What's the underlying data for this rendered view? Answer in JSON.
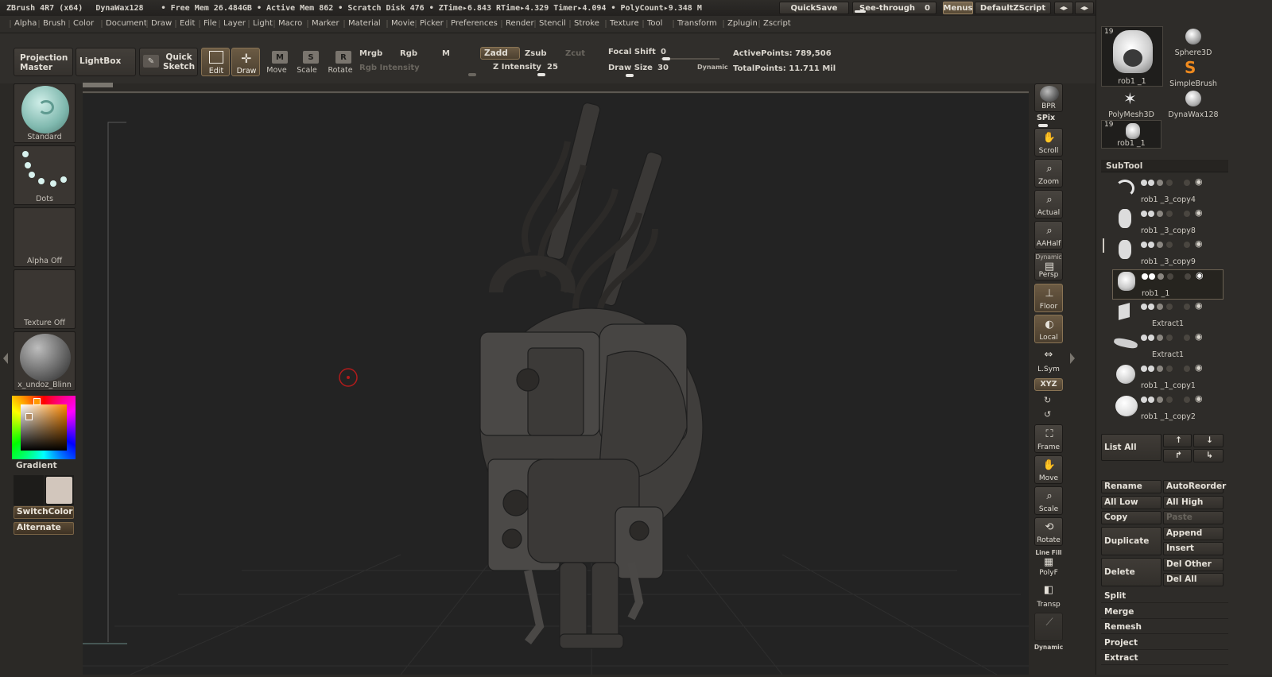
{
  "titlebar": {
    "app": "ZBrush 4R7 (x64)",
    "doc": "DynaWax128",
    "stats": "• Free Mem 26.484GB • Active Mem 862 • Scratch Disk 476 •  ZTime▸6.843 RTime▸4.329 Timer▸4.094 • PolyCount▸9.348 M",
    "quicksave": "QuickSave",
    "seethrough_label": "See-through",
    "seethrough_value": "0",
    "menus": "Menus",
    "script": "DefaultZScript"
  },
  "menubar": [
    "Alpha",
    "Brush",
    "Color",
    "Document",
    "Draw",
    "Edit",
    "File",
    "Layer",
    "Light",
    "Macro",
    "Marker",
    "Material",
    "Movie",
    "Picker",
    "Preferences",
    "Render",
    "Stencil",
    "Stroke",
    "Texture",
    "Tool",
    "Transform",
    "Zplugin",
    "Zscript"
  ],
  "toolbar": {
    "projection_master": "Projection Master",
    "lightbox": "LightBox",
    "quick_sketch": "Quick Sketch",
    "edit": "Edit",
    "draw": "Draw",
    "move": "Move",
    "scale": "Scale",
    "rotate": "Rotate",
    "mrgb": "Mrgb",
    "rgb": "Rgb",
    "m": "M",
    "zadd": "Zadd",
    "zsub": "Zsub",
    "zcut": "Zcut",
    "rgb_intensity": "Rgb Intensity",
    "z_intensity_label": "Z Intensity",
    "z_intensity_value": "25",
    "focal_shift_label": "Focal Shift",
    "focal_shift_value": "0",
    "draw_size_label": "Draw Size",
    "draw_size_value": "30",
    "dynamic": "Dynamic",
    "active_points": "ActivePoints: 789,506",
    "total_points": "TotalPoints: 11.711 Mil"
  },
  "leftshelf": {
    "brush": "Standard",
    "stroke": "Dots",
    "alpha": "Alpha  Off",
    "texture": "Texture  Off",
    "material": "x_undoz_Blinn",
    "gradient": "Gradient",
    "switchcolor": "SwitchColor",
    "alternate": "Alternate"
  },
  "rightshelf": {
    "bpr": "BPR",
    "spix": "SPix",
    "scroll": "Scroll",
    "zoom": "Zoom",
    "actual": "Actual",
    "aahalf": "AAHalf",
    "dynamic_persp": "Dynamic",
    "persp": "Persp",
    "floor": "Floor",
    "local": "Local",
    "lsym": "L.Sym",
    "xyz": "XYZ",
    "frame": "Frame",
    "move": "Move",
    "scale": "Scale",
    "rotate": "Rotate",
    "line_fill": "Line Fill",
    "polyf": "PolyF",
    "transp": "Transp",
    "dynamic_bottom": "Dynamic"
  },
  "tray": {
    "tool_count_1": "19",
    "tool_thumb_1": "rob1 _1",
    "tool_sphere": "Sphere3D",
    "tool_simplebrush": "SimpleBrush",
    "tool_polymesh": "PolyMesh3D",
    "tool_dynawax": "DynaWax128",
    "tool_count_2": "19",
    "tool_thumb_2": "rob1 _1",
    "subtool_header": "SubTool",
    "subtools": [
      {
        "name": "rob1 _3_copy4"
      },
      {
        "name": "rob1 _3_copy8"
      },
      {
        "name": "rob1 _3_copy9"
      },
      {
        "name": "rob1 _1"
      },
      {
        "name": "Extract1"
      },
      {
        "name": "Extract1"
      },
      {
        "name": "rob1 _1_copy1"
      },
      {
        "name": "rob1 _1_copy2"
      }
    ],
    "list_all": "List  All",
    "rename": "Rename",
    "autoreorder": "AutoReorder",
    "all_low": "All Low",
    "all_high": "All High",
    "copy": "Copy",
    "paste": "Paste",
    "duplicate": "Duplicate",
    "append": "Append",
    "insert": "Insert",
    "delete": "Delete",
    "del_other": "Del Other",
    "del_all": "Del All",
    "split": "Split",
    "merge": "Merge",
    "remesh": "Remesh",
    "project": "Project",
    "extract": "Extract"
  }
}
